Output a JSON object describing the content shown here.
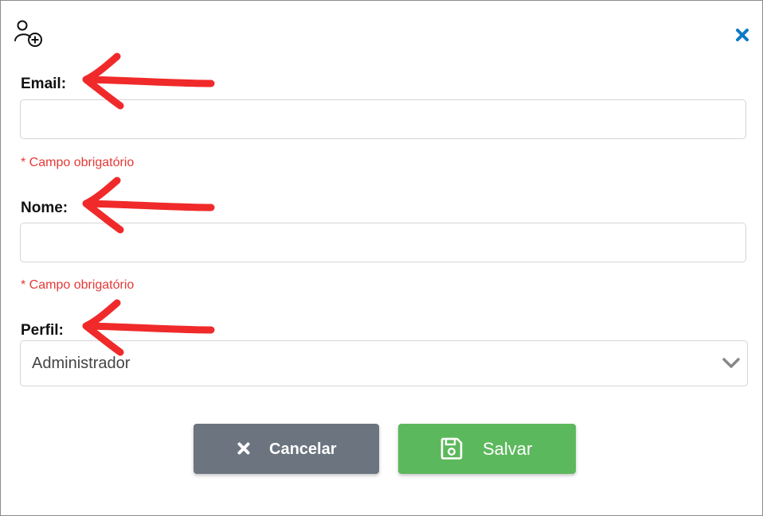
{
  "dialog": {
    "header_icon": "add-user-icon",
    "close_icon": "close-icon"
  },
  "form": {
    "email": {
      "label": "Email:",
      "value": "",
      "error": "* Campo obrigatório"
    },
    "nome": {
      "label": "Nome:",
      "value": "",
      "error": "* Campo obrigatório"
    },
    "perfil": {
      "label": "Perfil:",
      "selected": "Administrador"
    }
  },
  "actions": {
    "cancel_label": "Cancelar",
    "cancel_icon": "times-icon",
    "save_label": "Salvar",
    "save_icon": "floppy-disk-icon"
  },
  "annotations": {
    "arrow_color": "#f02a2a",
    "arrow_count": 3
  },
  "colors": {
    "accent": "#0d79c6",
    "error": "#e53935",
    "cancel": "#6b747f",
    "save": "#5cb85c"
  }
}
